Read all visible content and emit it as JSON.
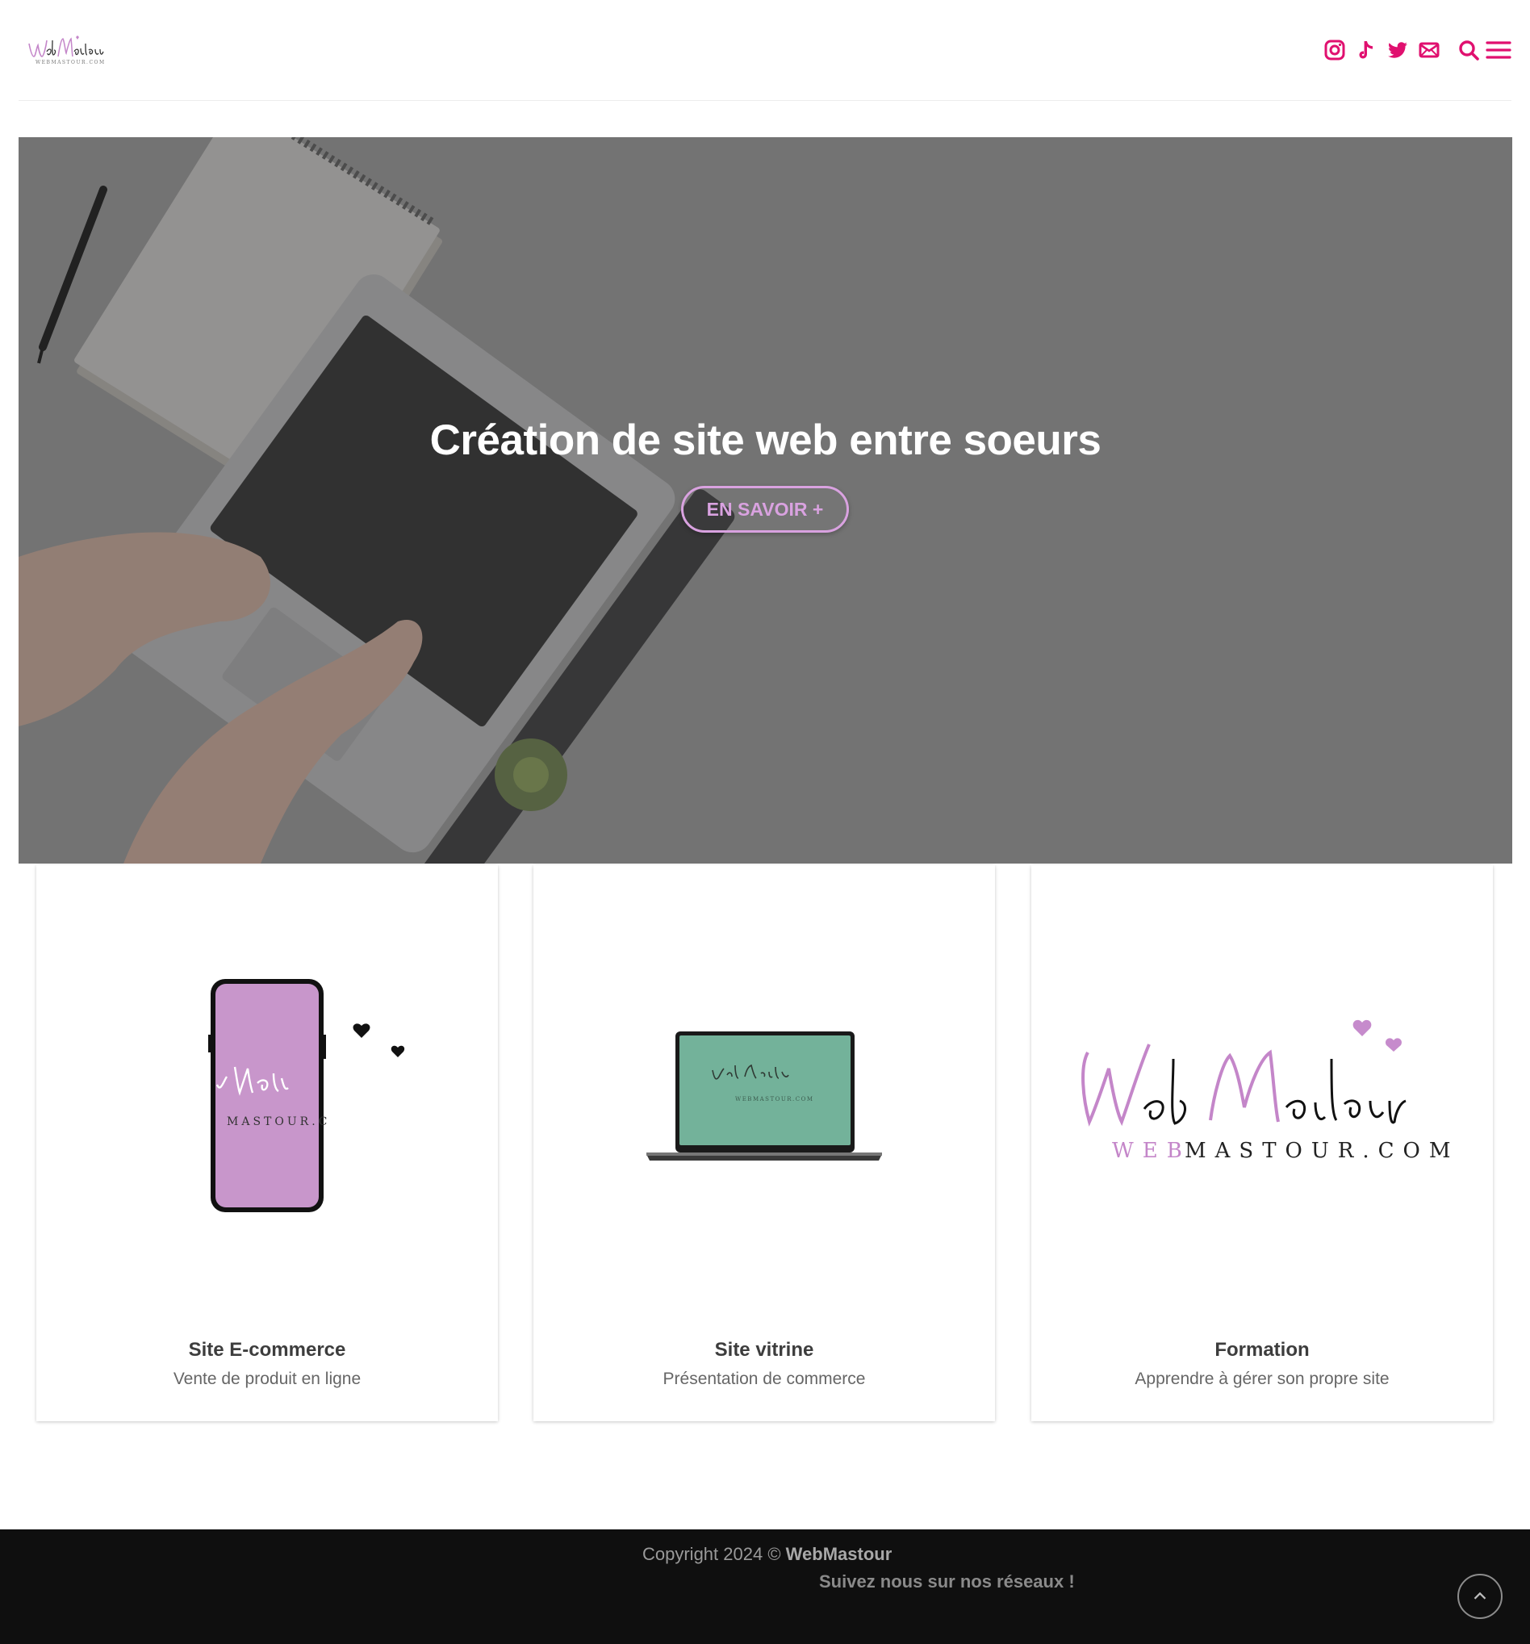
{
  "header": {
    "logo_alt": "WebMastour",
    "logo_small": "WEBMASTOUR.COM",
    "icons": [
      "instagram-icon",
      "tiktok-icon",
      "twitter-icon",
      "email-icon",
      "search-icon",
      "menu-icon"
    ]
  },
  "hero": {
    "title": "Création de site web entre soeurs",
    "button_label": "EN SAVOIR +"
  },
  "cards": [
    {
      "title": "Site E-commerce",
      "subtitle": "Vente de produit en ligne"
    },
    {
      "title": "Site vitrine",
      "subtitle": "Présentation de commerce"
    },
    {
      "title": "Formation",
      "subtitle": "Apprendre à gérer son propre site"
    }
  ],
  "card_art": {
    "phone_text": "MASTOUR.C",
    "laptop_text": "WEBMASTOUR.COM",
    "logo_big_script": "WebMastour",
    "logo_big_web": "WEB",
    "logo_big_rest": "MASTOUR.COM"
  },
  "footer": {
    "copyright_prefix": "Copyright 2024 © ",
    "brand": "WebMastour",
    "follow": "Suivez nous sur nos réseaux !"
  },
  "colors": {
    "accent": "#e0106f",
    "button_pink": "#d9a2e0",
    "phone_purple": "#c896cb",
    "laptop_green": "#73b29a",
    "footer_bg": "#0f0f0f"
  }
}
